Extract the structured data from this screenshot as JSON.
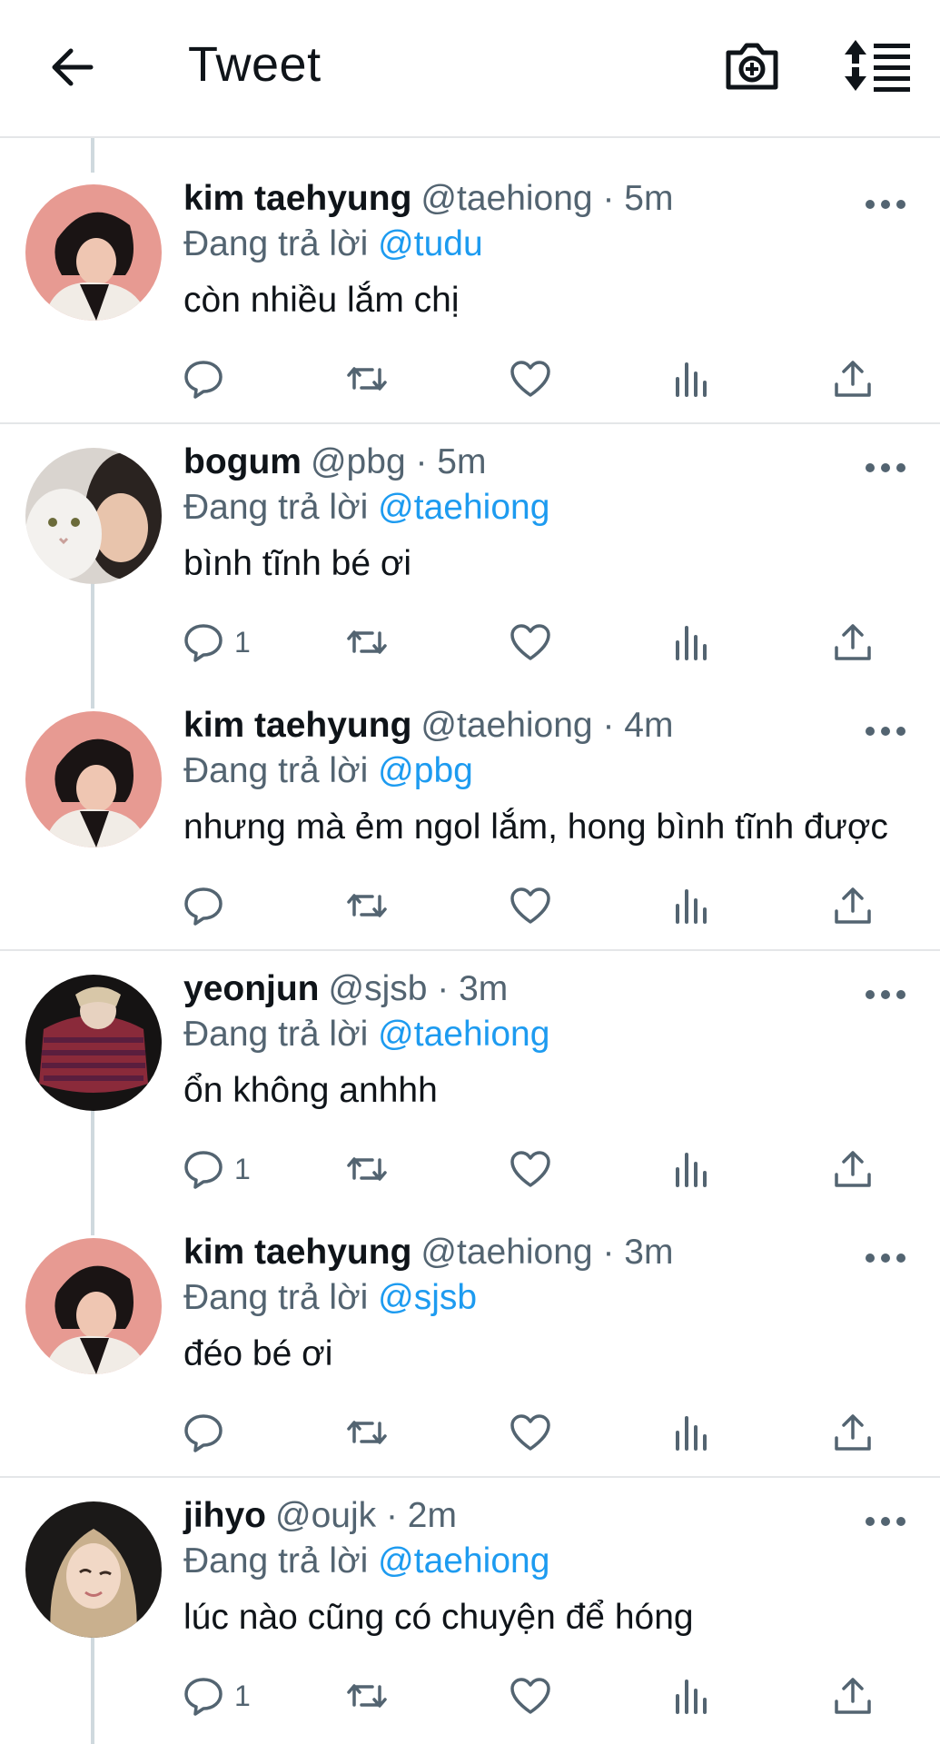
{
  "header": {
    "title": "Tweet",
    "back_icon": "arrow-left-icon",
    "camera_icon": "camera-plus-icon",
    "sort_icon": "sort-replies-icon"
  },
  "colors": {
    "text": "#0f1419",
    "secondary": "#536471",
    "link": "#1d9bf0",
    "divider": "#e4e6e8",
    "thread_line": "#cfd9de"
  },
  "reply_prefix": "Đang trả lời",
  "tweets": [
    {
      "name": "kim taehyung",
      "handle": "@taehiong",
      "time": "5m",
      "meta": "@taehiong · 5m",
      "reply_to": "@tudu",
      "text": "còn nhiều lắm chị",
      "reply_count": ""
    },
    {
      "name": "bogum",
      "handle": "@pbg",
      "time": "5m",
      "meta": "@pbg · 5m",
      "reply_to": "@taehiong",
      "text": "bình tĩnh bé ơi",
      "reply_count": "1"
    },
    {
      "name": "kim taehyung",
      "handle": "@taehiong",
      "time": "4m",
      "meta": "@taehiong · 4m",
      "reply_to": "@pbg",
      "text": "nhưng mà ẻm ngol lắm, hong bình tĩnh được",
      "reply_count": ""
    },
    {
      "name": "yeonjun",
      "handle": "@sjsb",
      "time": "3m",
      "meta": "@sjsb · 3m",
      "reply_to": "@taehiong",
      "text": "ổn không anhhh",
      "reply_count": "1"
    },
    {
      "name": "kim taehyung",
      "handle": "@taehiong",
      "time": "3m",
      "meta": "@taehiong · 3m",
      "reply_to": "@sjsb",
      "text": "đéo bé ơi",
      "reply_count": ""
    },
    {
      "name": "jihyo",
      "handle": "@oujk",
      "time": "2m",
      "meta": "@oujk · 2m",
      "reply_to": "@taehiong",
      "text": "lúc nào cũng có chuyện để hóng",
      "reply_count": "1"
    }
  ]
}
